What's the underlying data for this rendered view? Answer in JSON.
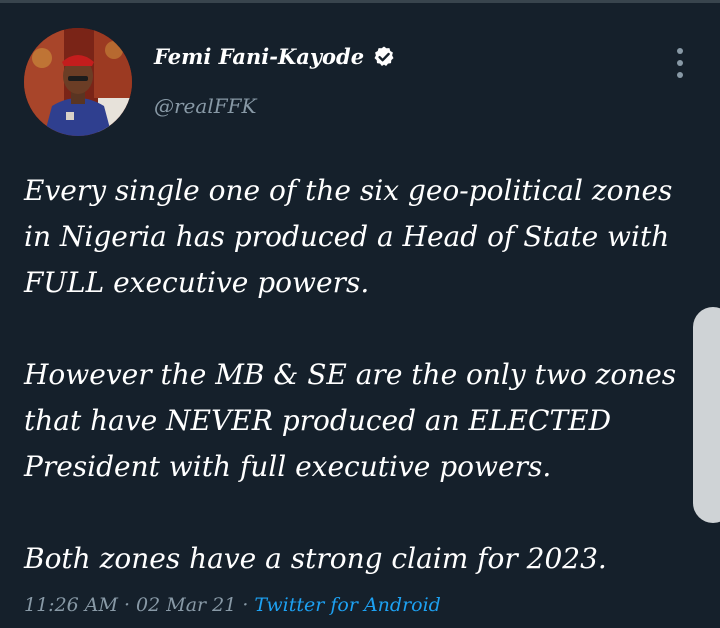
{
  "tweet": {
    "author": {
      "display_name": "Femi Fani-Kayode",
      "handle": "@realFFK",
      "verified": true
    },
    "paragraphs": [
      [
        "Every single one of the six geo-political zones",
        "in Nigeria has produced a Head of State with",
        "FULL executive powers."
      ],
      [
        "However the MB & SE are the only two zones",
        "that have NEVER produced an ELECTED",
        "President with full executive powers."
      ],
      [
        "Both zones have a strong claim for 2023."
      ]
    ],
    "time": "11:26 AM",
    "date": "02 Mar 21",
    "source": "Twitter for Android",
    "separator": "·"
  },
  "icons": {
    "verified": "verified-badge-icon",
    "more": "more-vertical-icon"
  },
  "colors": {
    "background": "#15202b",
    "text": "#ffffff",
    "secondary_text": "#8899a6",
    "link": "#1da1f2",
    "divider": "#38444d",
    "scroll_handle": "#cfd3d6"
  }
}
